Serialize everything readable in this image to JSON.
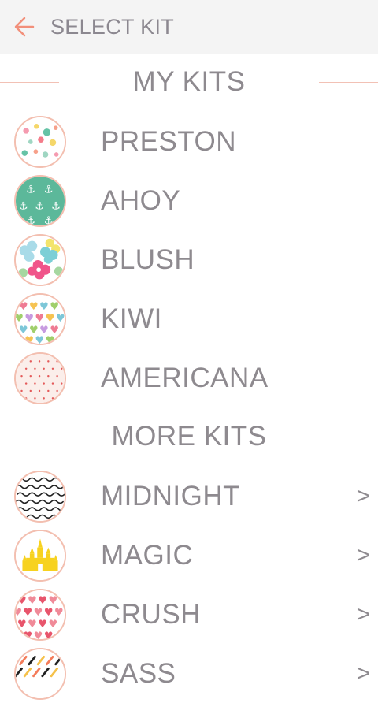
{
  "header": {
    "title": "SELECT KIT",
    "back_icon": "back-arrow-icon",
    "accent": "#f28f7a"
  },
  "my_kits": {
    "title": "MY KITS",
    "items": [
      {
        "name": "PRESTON"
      },
      {
        "name": "AHOY"
      },
      {
        "name": "BLUSH"
      },
      {
        "name": "KIWI"
      },
      {
        "name": "AMERICANA"
      }
    ]
  },
  "more_kits": {
    "title": "MORE KITS",
    "items": [
      {
        "name": "MIDNIGHT",
        "chevron": ">"
      },
      {
        "name": "MAGIC",
        "chevron": ">"
      },
      {
        "name": "CRUSH",
        "chevron": ">"
      },
      {
        "name": "SASS",
        "chevron": ">"
      }
    ]
  }
}
